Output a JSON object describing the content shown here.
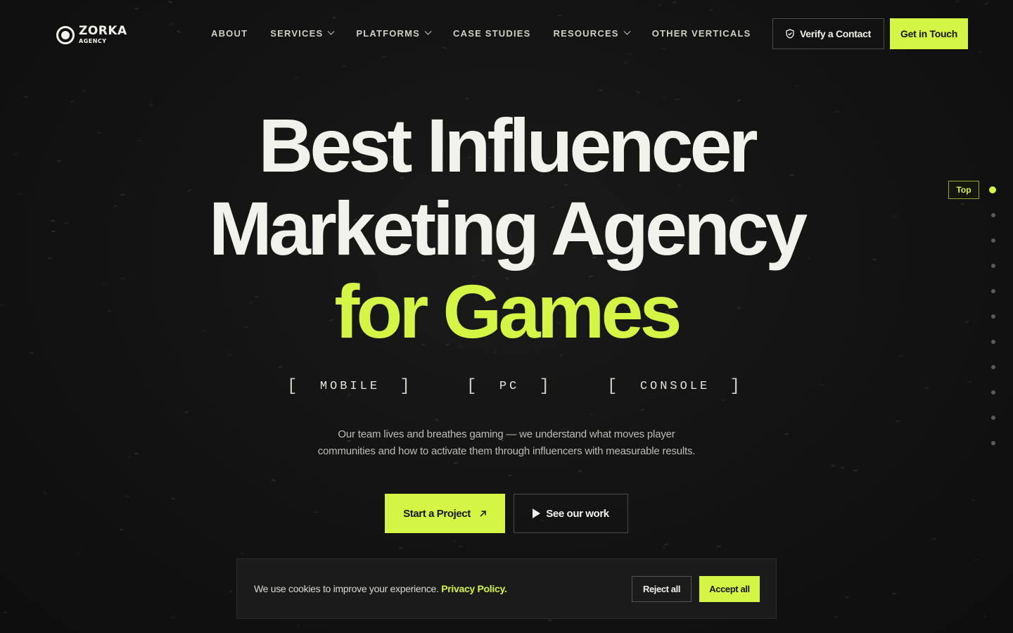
{
  "brand": {
    "name": "ZORKA",
    "sub": "AGENCY"
  },
  "nav": {
    "items": [
      {
        "label": "ABOUT",
        "dropdown": false
      },
      {
        "label": "SERVICES",
        "dropdown": true
      },
      {
        "label": "PLATFORMS",
        "dropdown": true
      },
      {
        "label": "CASE STUDIES",
        "dropdown": false
      },
      {
        "label": "RESOURCES",
        "dropdown": true
      },
      {
        "label": "OTHER VERTICALS",
        "dropdown": false
      }
    ]
  },
  "header": {
    "verify_label": "Verify a Contact",
    "cta_label": "Get in Touch"
  },
  "hero": {
    "line1": "Best Influencer",
    "line2": "Marketing Agency",
    "line3": "for Games",
    "platforms": [
      "MOBILE",
      "PC",
      "CONSOLE"
    ],
    "description_line1": "Our team lives and breathes gaming — we understand what moves player",
    "description_line2": "communities and how to activate them through influencers with measurable results.",
    "primary_cta": "Start a Project",
    "secondary_cta": "See our work"
  },
  "side_nav": {
    "active_label": "Top",
    "dot_count": 11,
    "active_index": 0
  },
  "cookie": {
    "text": "We use cookies to improve your experience.",
    "link": "Privacy Policy.",
    "reject": "Reject all",
    "accept": "Accept all"
  },
  "colors": {
    "accent": "#d4f543",
    "background": "#121212",
    "text": "#f2f2ec"
  }
}
